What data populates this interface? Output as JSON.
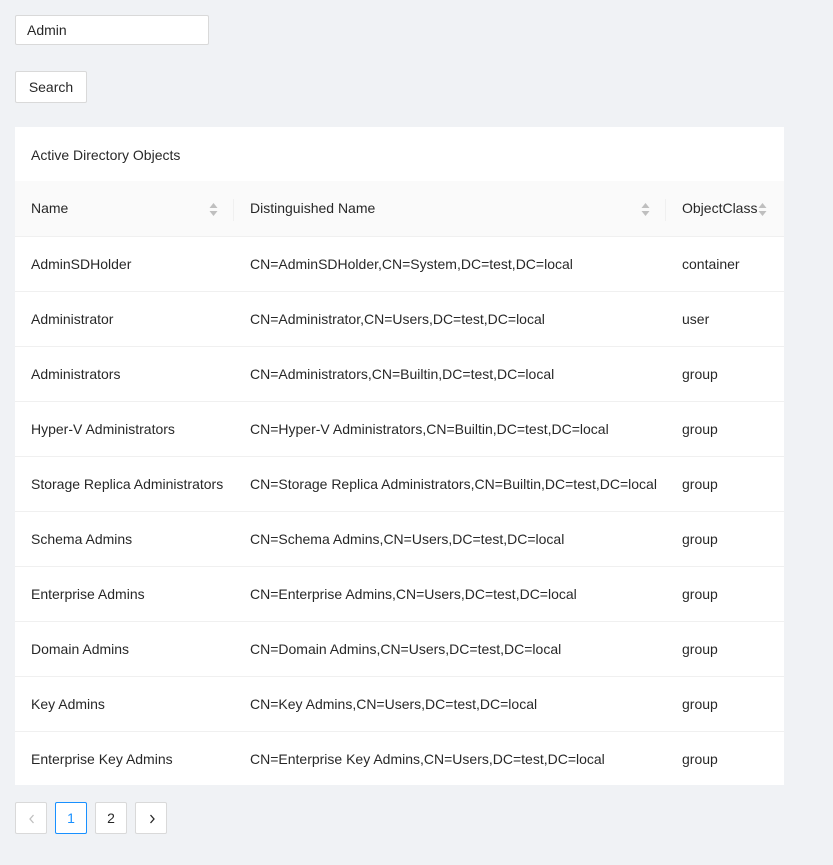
{
  "search": {
    "value": "Admin",
    "button_label": "Search"
  },
  "card": {
    "title": "Active Directory Objects"
  },
  "table": {
    "columns": [
      "Name",
      "Distinguished Name",
      "ObjectClass"
    ],
    "rows": [
      [
        "AdminSDHolder",
        "CN=AdminSDHolder,CN=System,DC=test,DC=local",
        "container"
      ],
      [
        "Administrator",
        "CN=Administrator,CN=Users,DC=test,DC=local",
        "user"
      ],
      [
        "Administrators",
        "CN=Administrators,CN=Builtin,DC=test,DC=local",
        "group"
      ],
      [
        "Hyper-V Administrators",
        "CN=Hyper-V Administrators,CN=Builtin,DC=test,DC=local",
        "group"
      ],
      [
        "Storage Replica Administrators",
        "CN=Storage Replica Administrators,CN=Builtin,DC=test,DC=local",
        "group"
      ],
      [
        "Schema Admins",
        "CN=Schema Admins,CN=Users,DC=test,DC=local",
        "group"
      ],
      [
        "Enterprise Admins",
        "CN=Enterprise Admins,CN=Users,DC=test,DC=local",
        "group"
      ],
      [
        "Domain Admins",
        "CN=Domain Admins,CN=Users,DC=test,DC=local",
        "group"
      ],
      [
        "Key Admins",
        "CN=Key Admins,CN=Users,DC=test,DC=local",
        "group"
      ],
      [
        "Enterprise Key Admins",
        "CN=Enterprise Key Admins,CN=Users,DC=test,DC=local",
        "group"
      ]
    ]
  },
  "pagination": {
    "pages": [
      "1",
      "2"
    ],
    "current": "1",
    "prev_icon": "chevron-left-icon",
    "next_icon": "chevron-right-icon"
  },
  "colors": {
    "background": "#f0f2f5",
    "accent": "#1890ff",
    "header_background": "#fafafa",
    "border": "#d9d9d9"
  }
}
